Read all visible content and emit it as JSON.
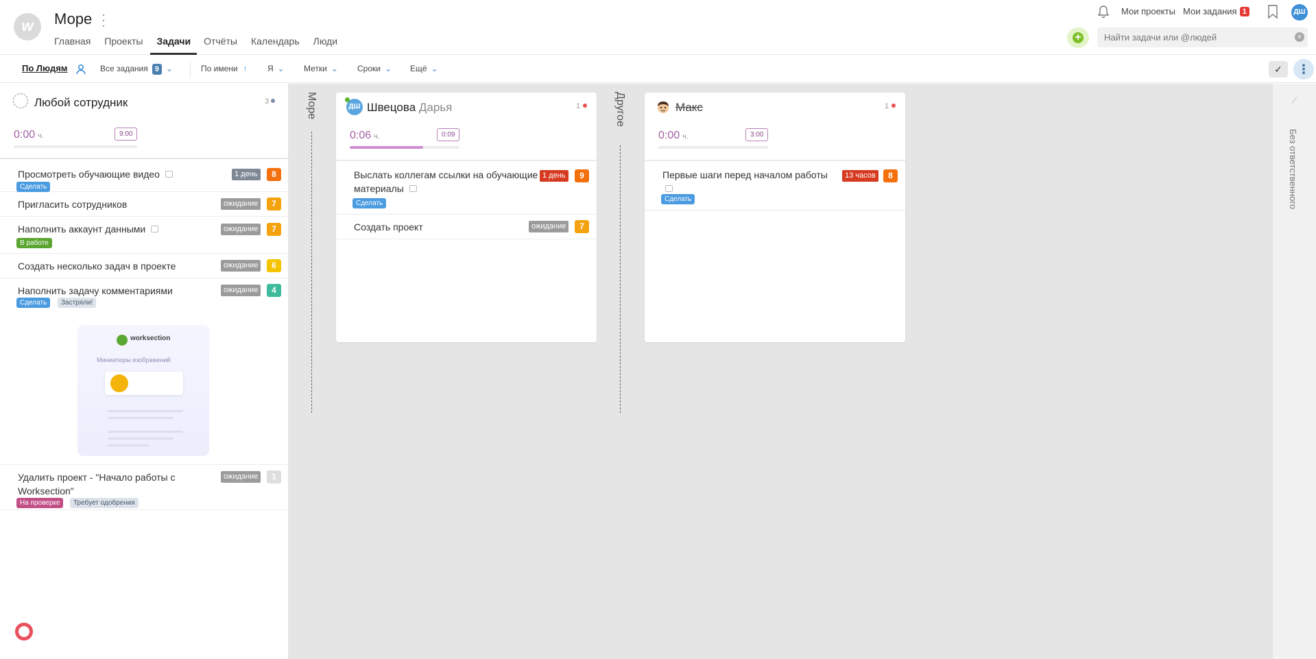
{
  "header": {
    "logo": "w",
    "project_title": "Море",
    "tabs": [
      "Главная",
      "Проекты",
      "Задачи",
      "Отчёты",
      "Календарь",
      "Люди"
    ],
    "active_tab": "Задачи",
    "my_projects": "Мои проекты",
    "my_tasks": "Мои задания",
    "my_tasks_count": "1",
    "avatar": "ДШ",
    "search_placeholder": "Найти задачи или @людей"
  },
  "filters": {
    "by_people": "По Людям",
    "all_tasks": "Все задания",
    "all_tasks_count": "9",
    "sort": "По имени",
    "me": "Я",
    "tags": "Метки",
    "deadlines": "Сроки",
    "more": "Ещё"
  },
  "left_panel": {
    "title": "Любой сотрудник",
    "count": "3",
    "time": "0:00",
    "time_unit": "ч.",
    "plan": "9:00",
    "tasks": [
      {
        "title": "Просмотреть обучающие видео",
        "deadline": "1 день",
        "priority": "8",
        "tags": [
          "Сделать"
        ]
      },
      {
        "title": "Пригласить сотрудников",
        "status": "ожидание",
        "priority": "7"
      },
      {
        "title": "Наполнить аккаунт данными",
        "status": "ожидание",
        "priority": "7",
        "tags": [
          "В работе"
        ]
      },
      {
        "title": "Создать несколько задач в проекте",
        "status": "ожидание",
        "priority": "6"
      },
      {
        "title": "Наполнить задачу комментариями",
        "status": "ожидание",
        "priority": "4",
        "tags": [
          "Сделать",
          "Застряли!"
        ]
      },
      {
        "title": "Удалить проект - \"Начало работы с Worksection\"",
        "status": "ожидание",
        "priority": "1",
        "tags": [
          "На проверке",
          "Требует одобрения"
        ]
      }
    ],
    "preview": {
      "brand": "worksection",
      "subtitle": "Миниатюры изображений"
    }
  },
  "groups": [
    {
      "label": "Море"
    },
    {
      "label": "Другое"
    }
  ],
  "columns": [
    {
      "avatar": "ДШ",
      "surname": "Швецова",
      "name": "Дарья",
      "count": "1",
      "time": "0:06",
      "time_unit": "ч.",
      "plan": "0:09",
      "progress": 0.67,
      "tasks": [
        {
          "title": "Выслать коллегам ссылки на обучающие материалы",
          "deadline": "1 день",
          "priority": "9",
          "tags": [
            "Сделать"
          ]
        },
        {
          "title": "Создать проект",
          "status": "ожидание",
          "priority": "7"
        }
      ]
    },
    {
      "name": "Макс",
      "count": "1",
      "time": "0:00",
      "time_unit": "ч.",
      "plan": "3:00",
      "progress": 0,
      "tasks": [
        {
          "title": "Первые шаги перед началом работы",
          "deadline": "13 часов",
          "priority": "8",
          "tags": [
            "Сделать"
          ]
        }
      ]
    }
  ],
  "right_strip": {
    "label": "Без ответственного"
  },
  "colors": {
    "priority_8": "#f4700d",
    "priority_7": "#f5a210",
    "priority_6": "#f5c400",
    "priority_4": "#3dbb9c",
    "priority_1": "#dedede",
    "accent": "#3d8fd8"
  }
}
